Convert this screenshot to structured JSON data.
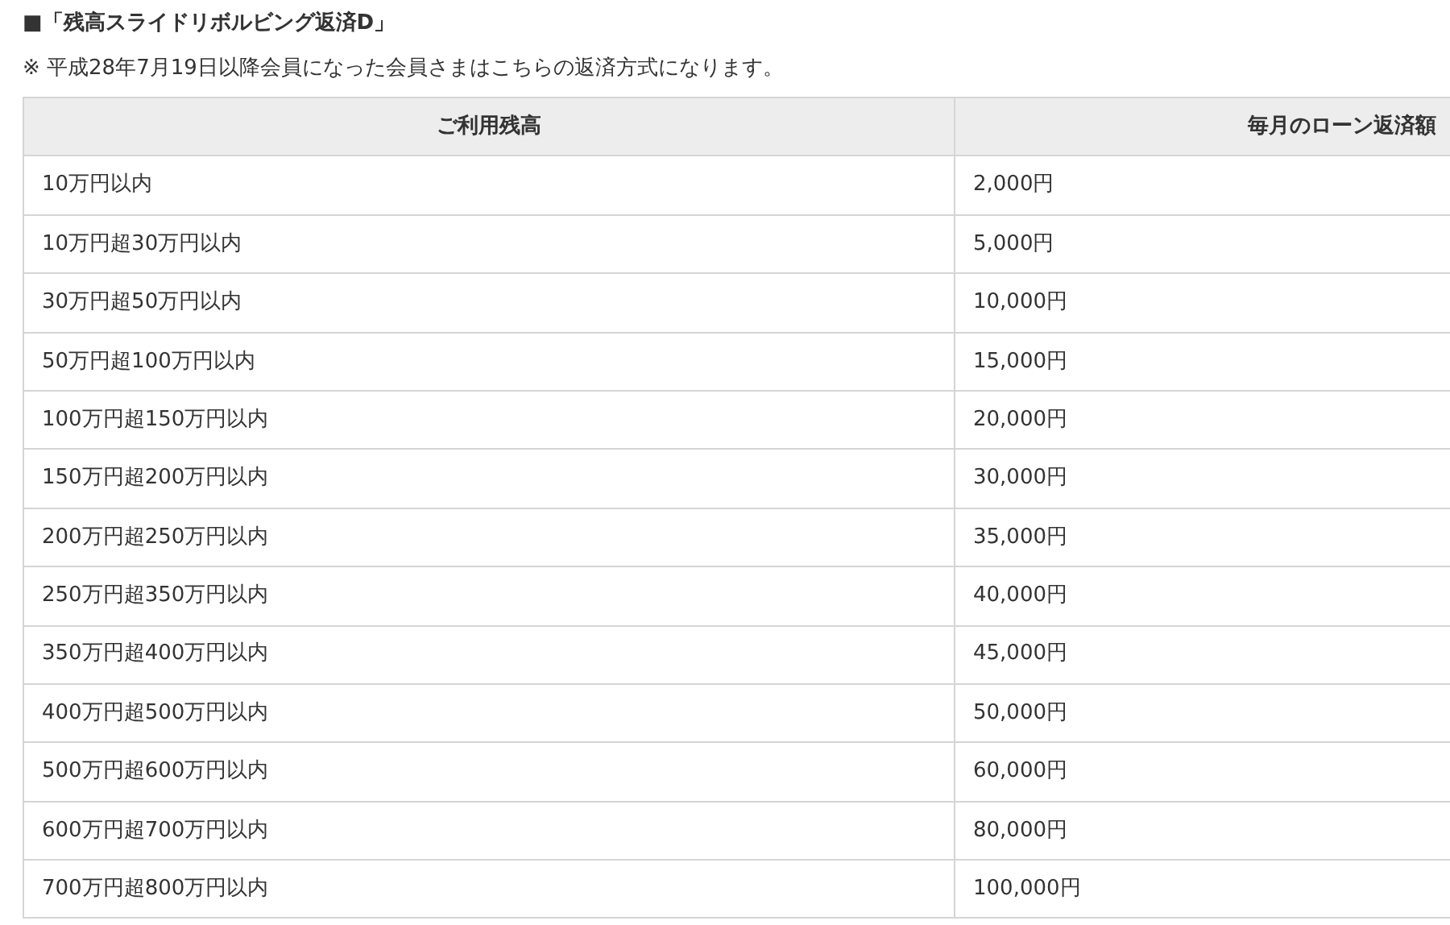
{
  "heading": "■「残高スライドリボルビング返済D」",
  "note": "※ 平成28年7月19日以降会員になった会員さまはこちらの返済方式になります。",
  "table": {
    "columns": [
      "ご利用残高",
      "毎月のローン返済額"
    ],
    "rows": [
      [
        "10万円以内",
        "2,000円"
      ],
      [
        "10万円超30万円以内",
        "5,000円"
      ],
      [
        "30万円超50万円以内",
        "10,000円"
      ],
      [
        "50万円超100万円以内",
        "15,000円"
      ],
      [
        "100万円超150万円以内",
        "20,000円"
      ],
      [
        "150万円超200万円以内",
        "30,000円"
      ],
      [
        "200万円超250万円以内",
        "35,000円"
      ],
      [
        "250万円超350万円以内",
        "40,000円"
      ],
      [
        "350万円超400万円以内",
        "45,000円"
      ],
      [
        "400万円超500万円以内",
        "50,000円"
      ],
      [
        "500万円超600万円以内",
        "60,000円"
      ],
      [
        "600万円超700万円以内",
        "80,000円"
      ],
      [
        "700万円超800万円以内",
        "100,000円"
      ]
    ]
  }
}
